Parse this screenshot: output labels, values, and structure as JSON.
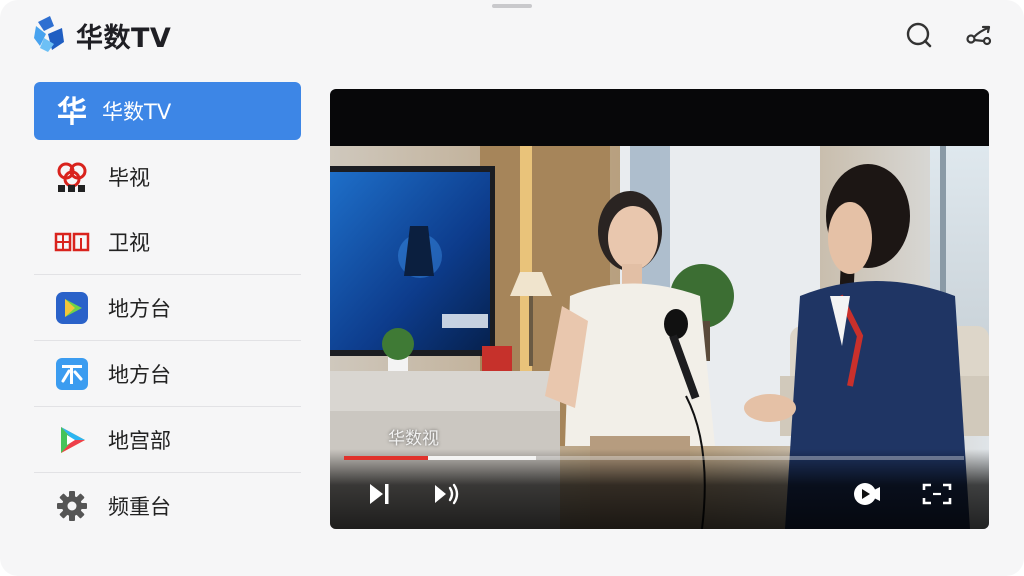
{
  "app": {
    "title": "华数TV",
    "brand_color": "#3d86e6"
  },
  "header": {
    "icons": [
      "search-icon",
      "share-icon"
    ]
  },
  "sidebar": {
    "items": [
      {
        "label": "华数TV",
        "icon": "huashu-icon",
        "active": true
      },
      {
        "label": "毕视",
        "icon": "cctv-logo-icon",
        "active": false
      },
      {
        "label": "卫视",
        "icon": "satellite-tv-logo-icon",
        "active": false
      },
      {
        "label": "地方台",
        "icon": "play-icon",
        "active": false
      },
      {
        "label": "地方台",
        "icon": "local-tv-icon",
        "active": false
      },
      {
        "label": "地宫部",
        "icon": "video-app-icon",
        "active": false
      },
      {
        "label": "频重台",
        "icon": "gear-icon",
        "active": false
      }
    ]
  },
  "player": {
    "watermark": "华数视",
    "progress": {
      "played": 0.135,
      "buffered": 0.31
    },
    "controls": [
      "next-icon",
      "volume-icon",
      "record-icon",
      "fullscreen-icon"
    ],
    "accent": "#e0322c"
  }
}
